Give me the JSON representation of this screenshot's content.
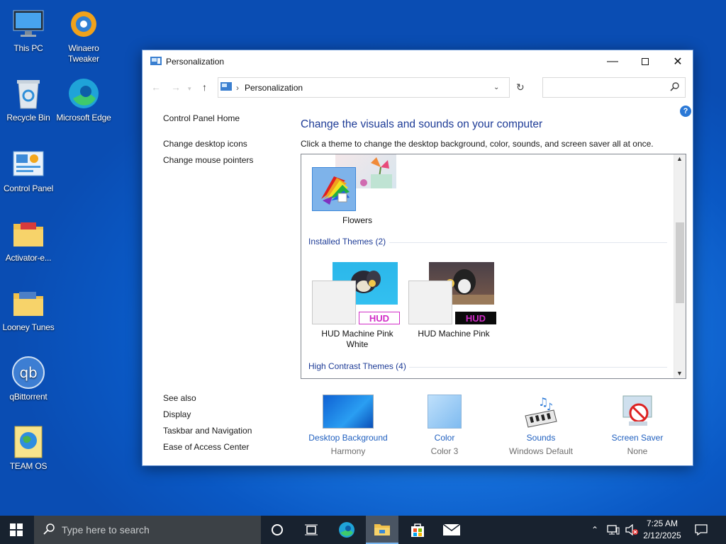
{
  "desktop": [
    {
      "label": "This PC",
      "icon": "monitor-icon"
    },
    {
      "label": "Winaero Tweaker",
      "icon": "winaero-icon"
    },
    {
      "label": "Recycle Bin",
      "icon": "recycle-bin-icon"
    },
    {
      "label": "Microsoft Edge",
      "icon": "edge-icon"
    },
    {
      "label": "Control Panel",
      "icon": "control-panel-icon"
    },
    {
      "label": "Activator-e...",
      "icon": "folder-icon"
    },
    {
      "label": "Looney Tunes",
      "icon": "folder-icon"
    },
    {
      "label": "qBittorrent",
      "icon": "qbittorrent-icon"
    },
    {
      "label": "TEAM OS",
      "icon": "globe-icon"
    }
  ],
  "window": {
    "title": "Personalization",
    "address": "Personalization",
    "search_placeholder": "",
    "left": {
      "home": "Control Panel Home",
      "desktop_icons": "Change desktop icons",
      "mouse": "Change mouse pointers",
      "see_also": "See also",
      "display": "Display",
      "taskbar": "Taskbar and Navigation",
      "ease": "Ease of Access Center"
    },
    "heading": "Change the visuals and sounds on your computer",
    "description": "Click a theme to change the desktop background, color, sounds, and screen saver all at once.",
    "themes": {
      "current": "Flowers",
      "installed_group": "Installed Themes (2)",
      "installed": [
        {
          "name": "HUD Machine Pink White",
          "badge": "HUD"
        },
        {
          "name": "HUD Machine Pink",
          "badge": "HUD"
        }
      ],
      "contrast_group": "High Contrast Themes (4)"
    },
    "bottom": [
      {
        "label": "Desktop Background",
        "value": "Harmony"
      },
      {
        "label": "Color",
        "value": "Color 3"
      },
      {
        "label": "Sounds",
        "value": "Windows Default"
      },
      {
        "label": "Screen Saver",
        "value": "None"
      }
    ]
  },
  "taskbar": {
    "search_placeholder": "Type here to search",
    "time": "7:25 AM",
    "date": "2/12/2025"
  },
  "colors": {
    "accent": "#1e3c97",
    "link": "#1f5fbf",
    "taskbar": "#18222f"
  }
}
